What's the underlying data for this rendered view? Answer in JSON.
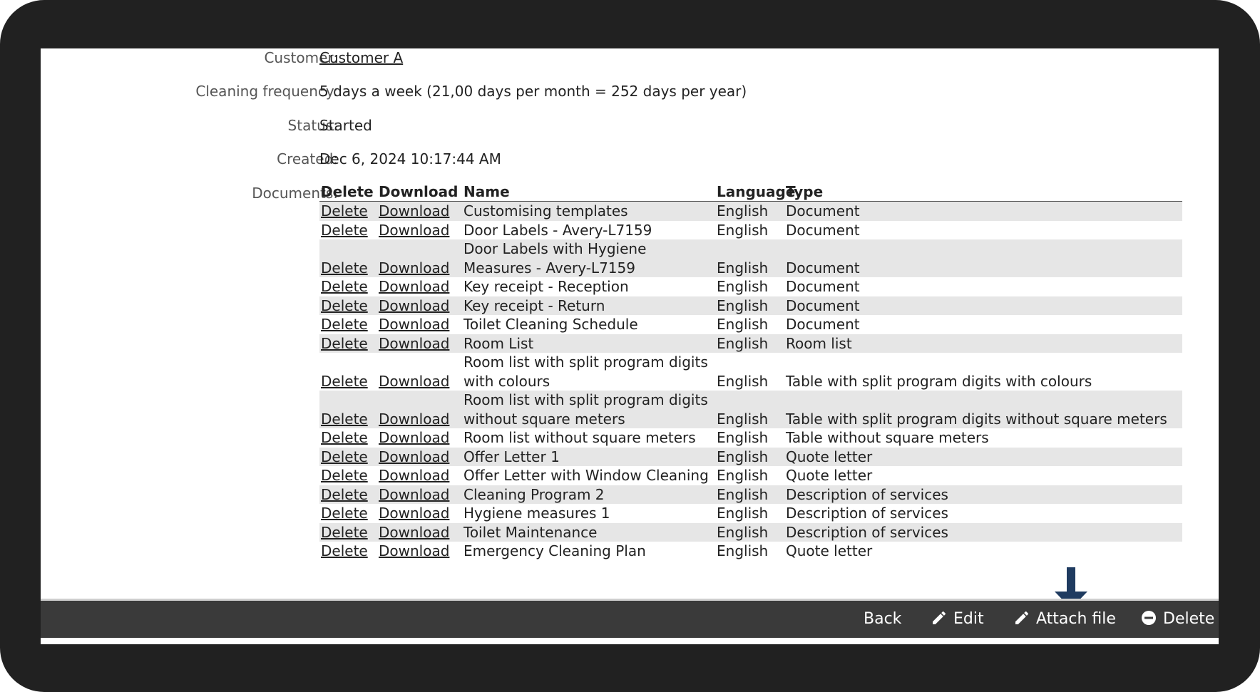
{
  "fields": [
    {
      "label": "Customer:",
      "value": "Customer A",
      "link": true
    },
    {
      "label": "Cleaning frequency:",
      "value": "5 days a week (21,00 days per month = 252 days per year)",
      "link": false
    },
    {
      "label": "Status:",
      "value": "Started",
      "link": false
    },
    {
      "label": "Created:",
      "value": "Dec 6, 2024 10:17:44 AM",
      "link": false
    }
  ],
  "documents": {
    "label": "Documents:",
    "columns": {
      "delete": "Delete",
      "download": "Download",
      "name": "Name",
      "language": "Language",
      "type": "Type"
    },
    "delete_link": "Delete",
    "download_link": "Download",
    "rows": [
      {
        "name": "Customising templates",
        "language": "English",
        "type": "Document"
      },
      {
        "name": "Door Labels - Avery-L7159",
        "language": "English",
        "type": "Document"
      },
      {
        "name": "Door Labels with Hygiene Measures - Avery-L7159",
        "language": "English",
        "type": "Document"
      },
      {
        "name": "Key receipt - Reception",
        "language": "English",
        "type": "Document"
      },
      {
        "name": "Key receipt - Return",
        "language": "English",
        "type": "Document"
      },
      {
        "name": "Toilet Cleaning Schedule",
        "language": "English",
        "type": "Document"
      },
      {
        "name": "Room List",
        "language": "English",
        "type": "Room list"
      },
      {
        "name": "Room list with split program digits with colours",
        "language": "English",
        "type": "Table with split program digits with colours"
      },
      {
        "name": "Room list with split program digits without square meters",
        "language": "English",
        "type": "Table with split program digits without square meters"
      },
      {
        "name": "Room list without square meters",
        "language": "English",
        "type": "Table without square meters"
      },
      {
        "name": "Offer Letter 1",
        "language": "English",
        "type": "Quote letter"
      },
      {
        "name": "Offer Letter with Window Cleaning",
        "language": "English",
        "type": "Quote letter"
      },
      {
        "name": "Cleaning Program 2",
        "language": "English",
        "type": "Description of services"
      },
      {
        "name": "Hygiene measures 1",
        "language": "English",
        "type": "Description of services"
      },
      {
        "name": "Toilet Maintenance",
        "language": "English",
        "type": "Description of services"
      },
      {
        "name": "Emergency Cleaning Plan",
        "language": "English",
        "type": "Quote letter"
      }
    ]
  },
  "toolbar": {
    "back": "Back",
    "edit": "Edit",
    "attach": "Attach file",
    "delete": "Delete"
  },
  "colors": {
    "frame": "#212121",
    "toolbar": "#3a3a3a",
    "row_alt": "#e6e6e6",
    "arrow": "#1f3b60"
  }
}
